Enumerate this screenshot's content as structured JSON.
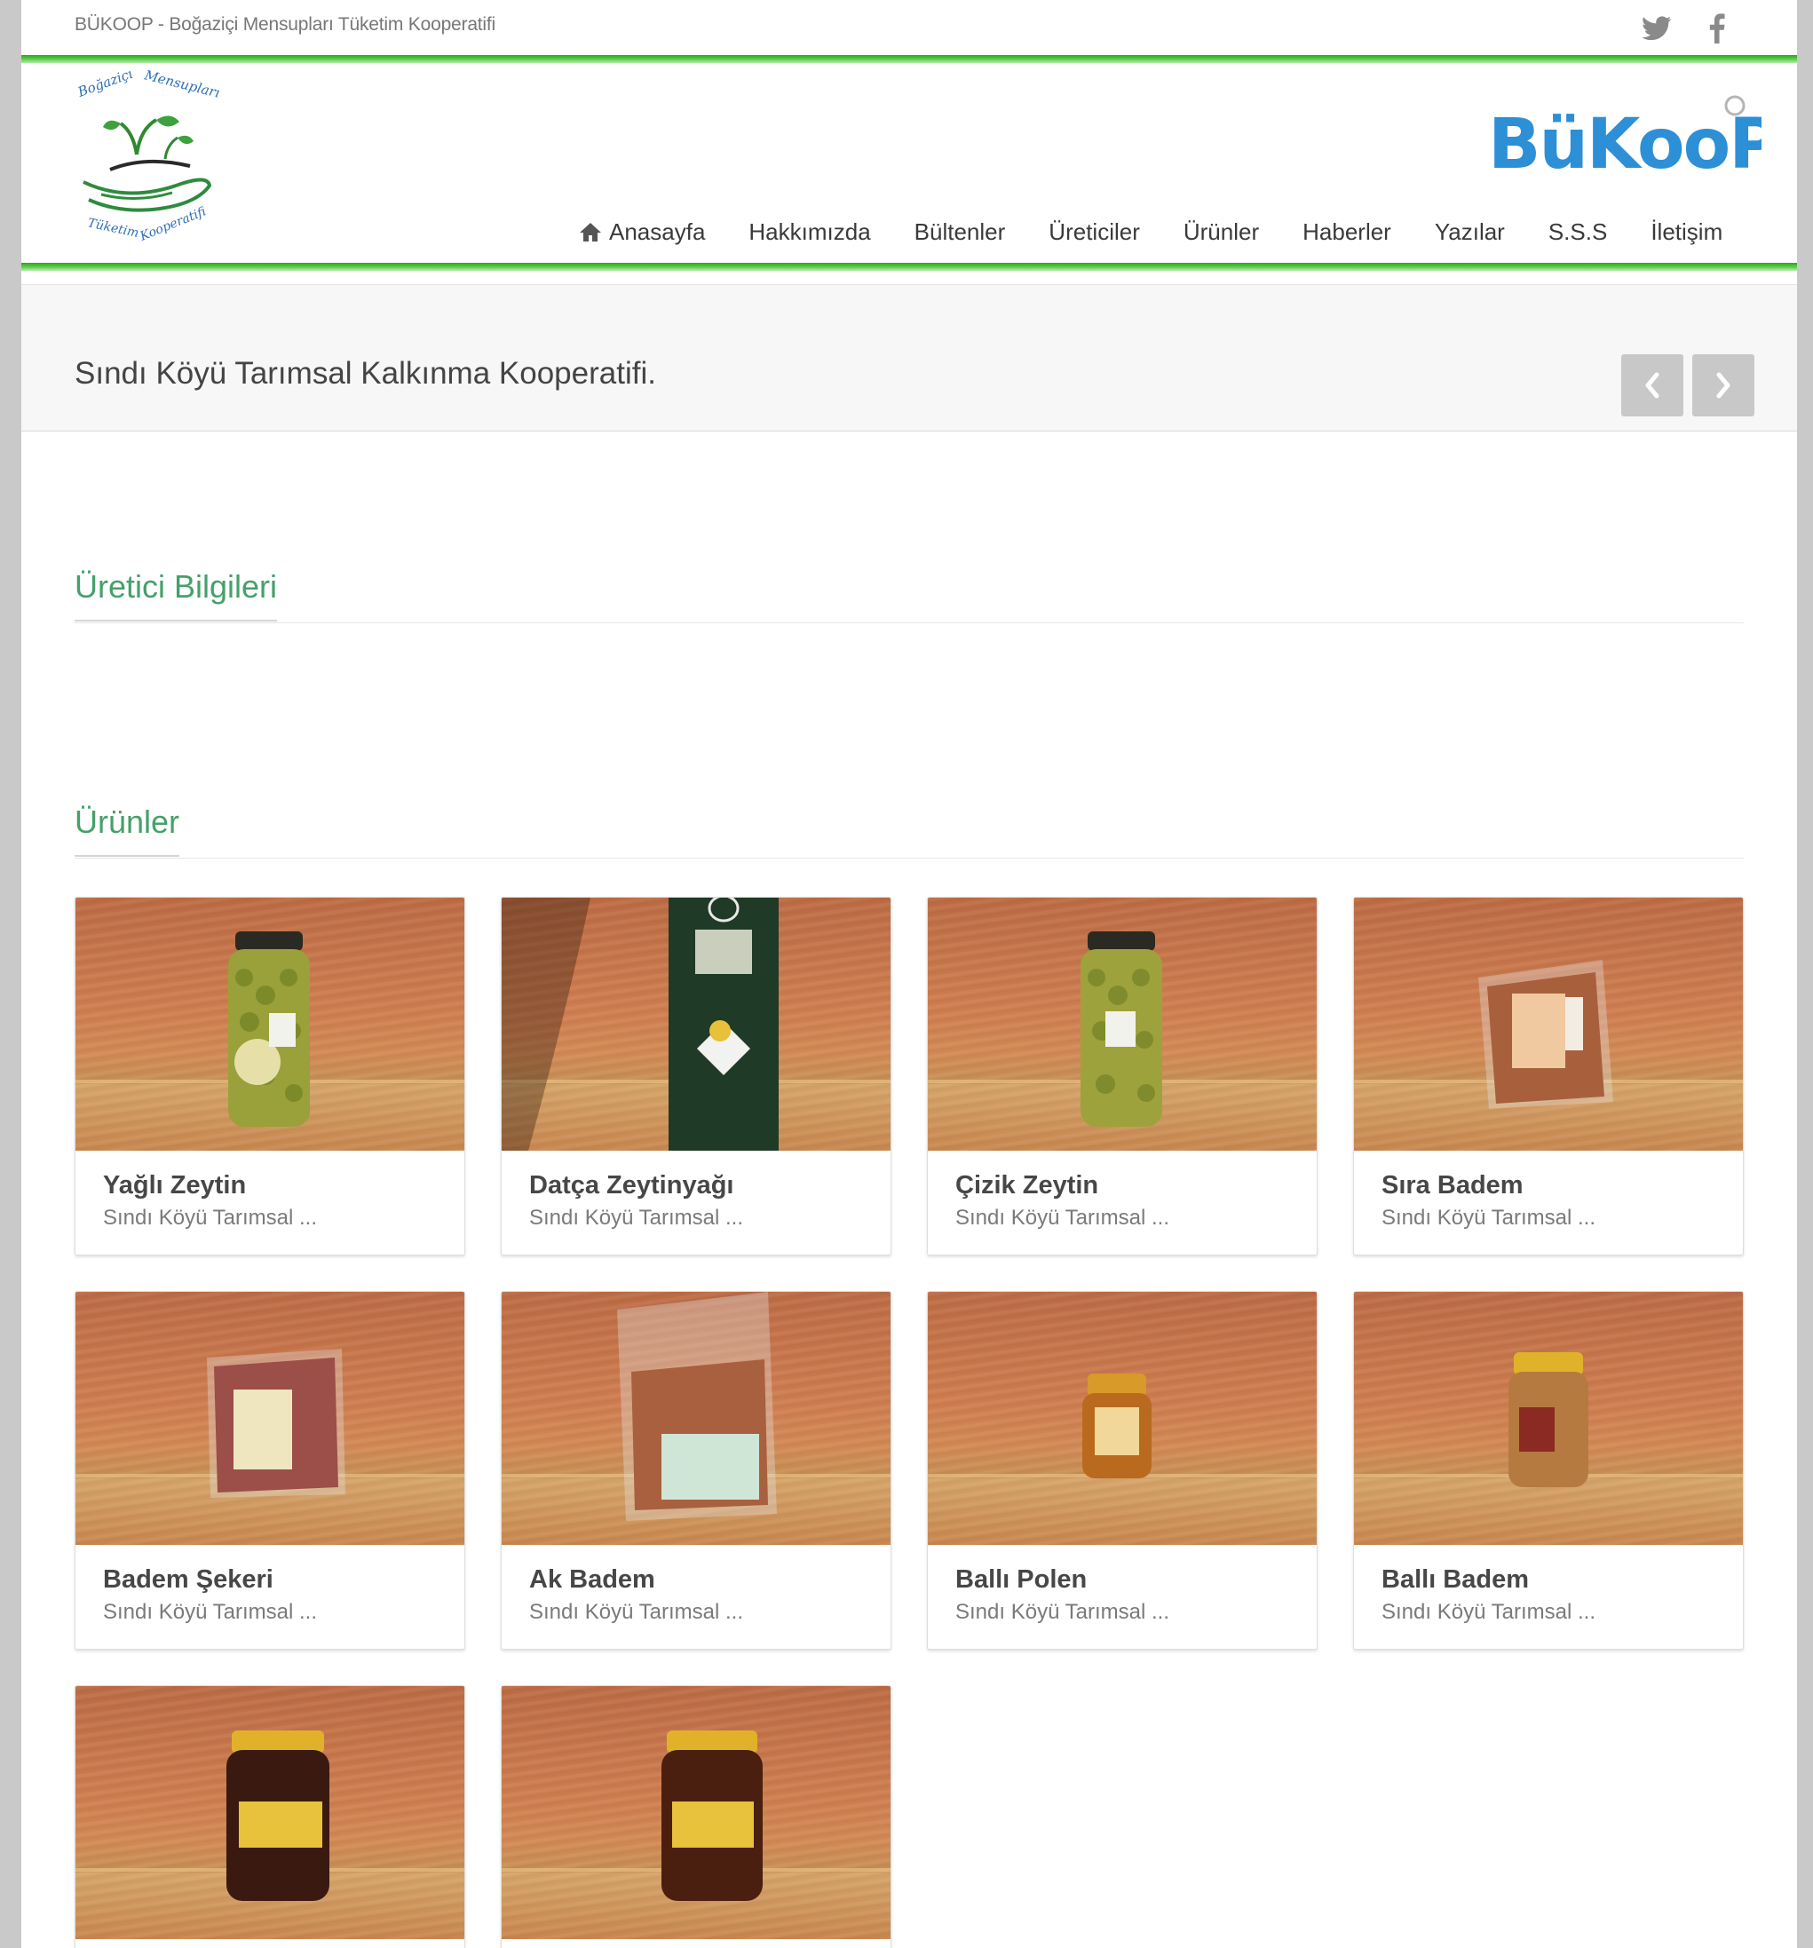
{
  "topbar": {
    "site_tag": "BÜKOOP - Boğaziçi Mensupları Tüketim Kooperatifi",
    "social": [
      {
        "icon": "twitter-icon"
      },
      {
        "icon": "facebook-icon"
      }
    ]
  },
  "header": {
    "brand_text": "BüKooP",
    "logo_text_top": "Boğaziçi Mensupları",
    "logo_text_bottom": "Tüketim Kooperatifi",
    "nav": [
      {
        "label": "Anasayfa",
        "icon": "home-icon"
      },
      {
        "label": "Hakkımızda"
      },
      {
        "label": "Bültenler"
      },
      {
        "label": "Üreticiler"
      },
      {
        "label": "Ürünler"
      },
      {
        "label": "Haberler"
      },
      {
        "label": "Yazılar"
      },
      {
        "label": "S.S.S"
      },
      {
        "label": "İletişim"
      }
    ]
  },
  "titlebar": {
    "title": "Sındı Köyü Tarımsal Kalkınma Kooperatifi.",
    "prev_icon": "chevron-left-icon",
    "next_icon": "chevron-right-icon"
  },
  "sections": {
    "producer_info": "Üretici Bilgileri",
    "products": "Ürünler"
  },
  "products": [
    {
      "name": "Yağlı Zeytin",
      "producer": "Sındı Köyü Tarımsal ..."
    },
    {
      "name": "Datça Zeytinyağı",
      "producer": "Sındı Köyü Tarımsal ..."
    },
    {
      "name": "Çizik Zeytin",
      "producer": "Sındı Köyü Tarımsal ..."
    },
    {
      "name": "Sıra Badem",
      "producer": "Sındı Köyü Tarımsal ..."
    },
    {
      "name": "Badem Şekeri",
      "producer": "Sındı Köyü Tarımsal ..."
    },
    {
      "name": "Ak Badem",
      "producer": "Sındı Köyü Tarımsal ..."
    },
    {
      "name": "Ballı Polen",
      "producer": "Sındı Köyü Tarımsal ..."
    },
    {
      "name": "Ballı Badem",
      "producer": "Sındı Köyü Tarımsal ..."
    },
    {
      "name": "",
      "producer": ""
    },
    {
      "name": "",
      "producer": ""
    }
  ],
  "colors": {
    "accent_green": "#45a06a",
    "nav_stripe": "#2aa520",
    "brand_blue": "#2d8fd6"
  }
}
